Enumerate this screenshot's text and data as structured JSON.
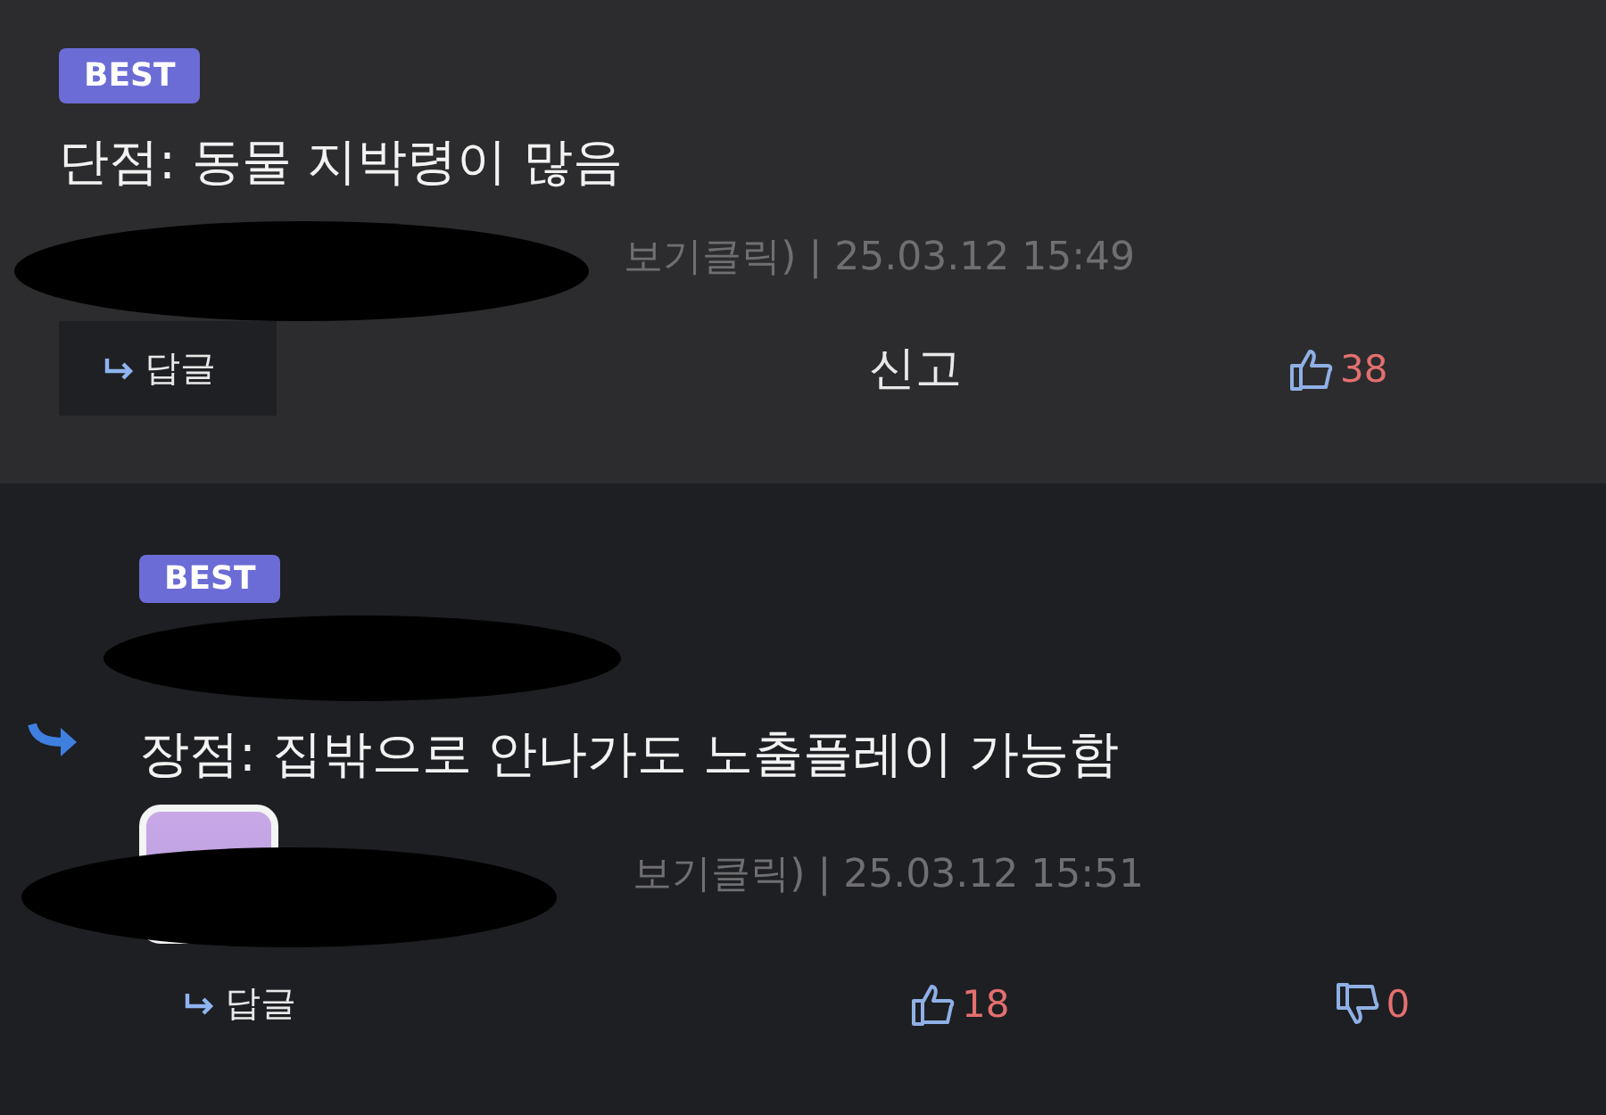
{
  "comments": [
    {
      "kind": "top",
      "badge": "BEST",
      "text": "단점: 동물 지박령이 많음",
      "meta": "보기클릭) | 25.03.12 15:49",
      "reply": "답글",
      "report": "신고",
      "likes": "38"
    },
    {
      "kind": "reply",
      "badge": "BEST",
      "text": "장점: 집밖으로 안나가도 노출플레이 가능함",
      "meta": "보기클릭) | 25.03.12 15:51",
      "reply": "답글",
      "likes": "18",
      "dislikes": "0"
    }
  ]
}
